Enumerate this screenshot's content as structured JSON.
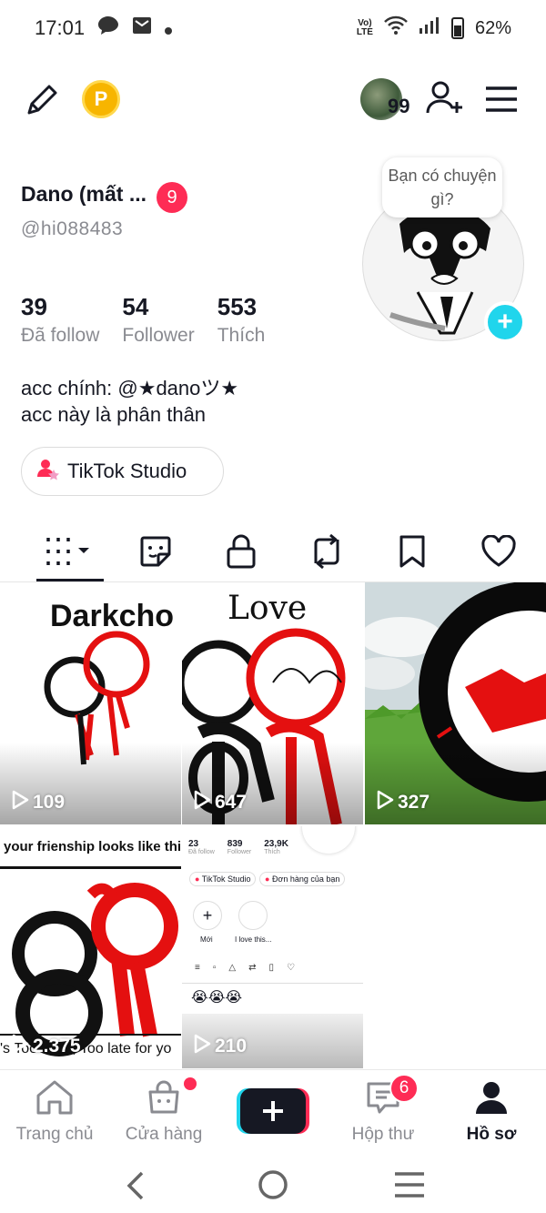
{
  "status_bar": {
    "time": "17:01",
    "network": "VoLTE",
    "battery": "62%"
  },
  "top_bar": {
    "coin_label": "P",
    "notification_count": "99"
  },
  "profile": {
    "display_name": "Dano (mất ...",
    "name_badge": "9",
    "username": "@hi088483",
    "bubble_text": "Bạn có chuyện gì?",
    "stats": [
      {
        "value": "39",
        "label": "Đã follow"
      },
      {
        "value": "54",
        "label": "Follower"
      },
      {
        "value": "553",
        "label": "Thích"
      }
    ],
    "bio_line1": "acc chính: @★danoツ★",
    "bio_line2": "acc này là phân thân",
    "studio_button": "TikTok Studio"
  },
  "tabs": [
    "videos",
    "stickers",
    "private",
    "reposts",
    "favorites",
    "liked"
  ],
  "videos": [
    {
      "title": "Darkcho",
      "views": "109"
    },
    {
      "title": "Love",
      "views": "647"
    },
    {
      "title": "",
      "views": "327"
    },
    {
      "caption_top": "your frienship looks like thi",
      "caption_bottom": "'s Too Little, Too late for yo",
      "views": "2.375"
    },
    {
      "views": "210",
      "embedded": {
        "stats": [
          {
            "v": "23",
            "l": "Đã follow"
          },
          {
            "v": "839",
            "l": "Follower"
          },
          {
            "v": "23,9K",
            "l": "Thích"
          }
        ],
        "studio": "TikTok Studio",
        "orders": "Đơn hàng của bạn",
        "new_label": "Mới",
        "story_label": "I love this...",
        "emoji": "😭😭😭"
      }
    }
  ],
  "bottom_nav": {
    "home": "Trang chủ",
    "shop": "Cửa hàng",
    "inbox": "Hộp thư",
    "inbox_badge": "6",
    "profile": "Hồ sơ"
  },
  "colors": {
    "accent_red": "#fe2c55",
    "accent_cyan": "#20d5ec",
    "text_secondary": "#8a8b91"
  }
}
